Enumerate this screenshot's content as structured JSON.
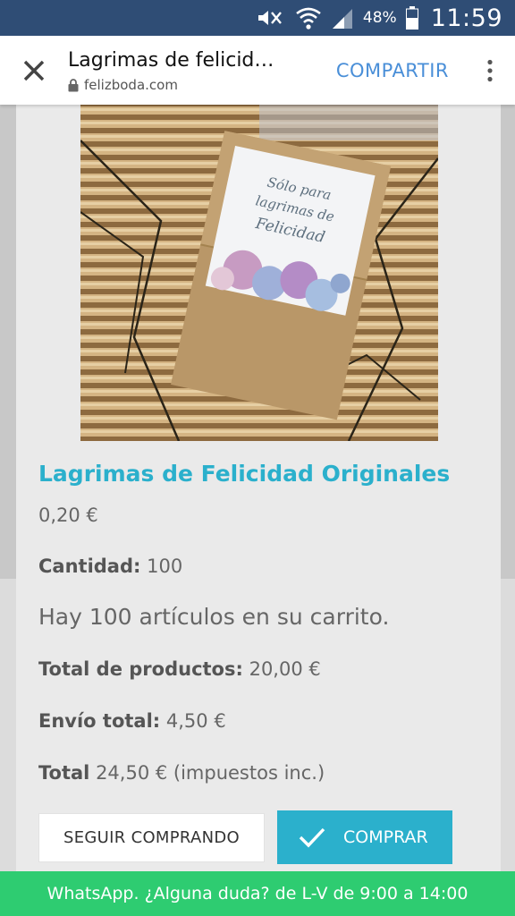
{
  "status_bar": {
    "battery": "48%",
    "time": "11:59",
    "icons": [
      "mute-icon",
      "wifi-icon",
      "signal-icon",
      "battery-icon"
    ]
  },
  "app_bar": {
    "title": "Lagrimas de felicid…",
    "domain": "felizboda.com",
    "share_label": "COMPARTIR",
    "icons": [
      "close-icon",
      "lock-icon",
      "more-vert-icon"
    ]
  },
  "product": {
    "name": "Lagrimas de Felicidad Originales",
    "price": "0,20 €",
    "quantity_label": "Cantidad:",
    "quantity_value": "100",
    "cart_message": "Hay 100 artículos en su carrito.",
    "subtotal_label": "Total de productos:",
    "subtotal_value": "20,00 €",
    "shipping_label": "Envío total:",
    "shipping_value": "4,50 €",
    "total_label": "Total",
    "total_value": "24,50 € (impuestos inc.)"
  },
  "image_text": {
    "line1": "Sólo para",
    "line2": "lagrimas de",
    "line3": "Felicidad"
  },
  "buttons": {
    "continue_label": "SEGUIR COMPRANDO",
    "buy_label": "COMPRAR"
  },
  "whatsapp_banner": "WhatsApp. ¿Alguna duda? de L-V de 9:00 a 14:00",
  "colors": {
    "status_bar": "#2f4d75",
    "accent": "#2bb0cc",
    "share": "#4a8fd8",
    "whatsapp": "#2ecc71"
  }
}
